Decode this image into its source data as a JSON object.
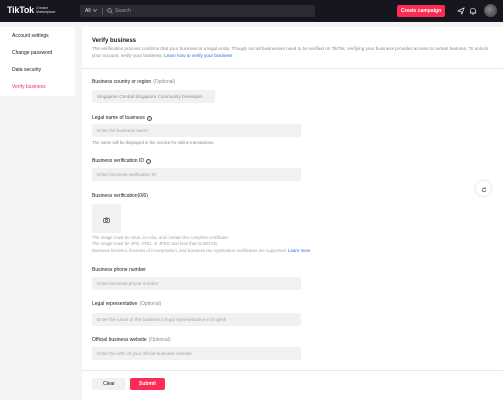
{
  "header": {
    "logo": "TikTok",
    "logo_sub_line1": "Creator",
    "logo_sub_line2": "Marketplace",
    "search_scope": "All",
    "search_placeholder": "Search",
    "create_campaign": "Create campaign",
    "icons": [
      "send-icon",
      "bell-icon",
      "avatar"
    ]
  },
  "sidebar": {
    "items": [
      {
        "label": "Account settings"
      },
      {
        "label": "Change password"
      },
      {
        "label": "Data security"
      },
      {
        "label": "Verify business"
      }
    ],
    "active_index": 3
  },
  "page": {
    "title": "Verify business",
    "description": "The verification process confirms that your business is a legal entity. Though not all businesses need to be verified on TikTok, verifying your business provides access to certain features. To unlock your account, verify your business.",
    "learn_more": "Learn how to verify your business"
  },
  "form": {
    "country": {
      "label": "Business country or region",
      "optional": "(Optional)",
      "value": "Singapore Central Singapore Community Developm"
    },
    "legal_name": {
      "label": "Legal name of business",
      "placeholder": "Enter the business name",
      "hint": "The name will be displayed in the invoice for online transactions."
    },
    "verification_id": {
      "label": "Business verification ID",
      "placeholder": "Enter business verification ID"
    },
    "verification_doc": {
      "label": "Business verification(0/6)",
      "notes": [
        "The image must be clear, in color, and contain the complete certificate.",
        "The image must be JPG, PNG, or JPEG and less than 5,000 KB.",
        "Business licenses, licenses of incorporation, and business tax registration certificates are supported."
      ],
      "learn_more": "Learn more"
    },
    "phone": {
      "label": "Business phone number",
      "placeholder": "Enter business phone number"
    },
    "legal_rep": {
      "label": "Legal representative",
      "optional": "(Optional)",
      "placeholder": "Enter the name of the business's legal representative in English"
    },
    "website": {
      "label": "Official business website",
      "optional": "(Optional)",
      "placeholder": "Enter the URL of your official business website"
    }
  },
  "actions": {
    "clear": "Clear",
    "submit": "Submit"
  },
  "colors": {
    "accent": "#fe2c55",
    "link": "#2a6be0",
    "topbar": "#16161e"
  }
}
